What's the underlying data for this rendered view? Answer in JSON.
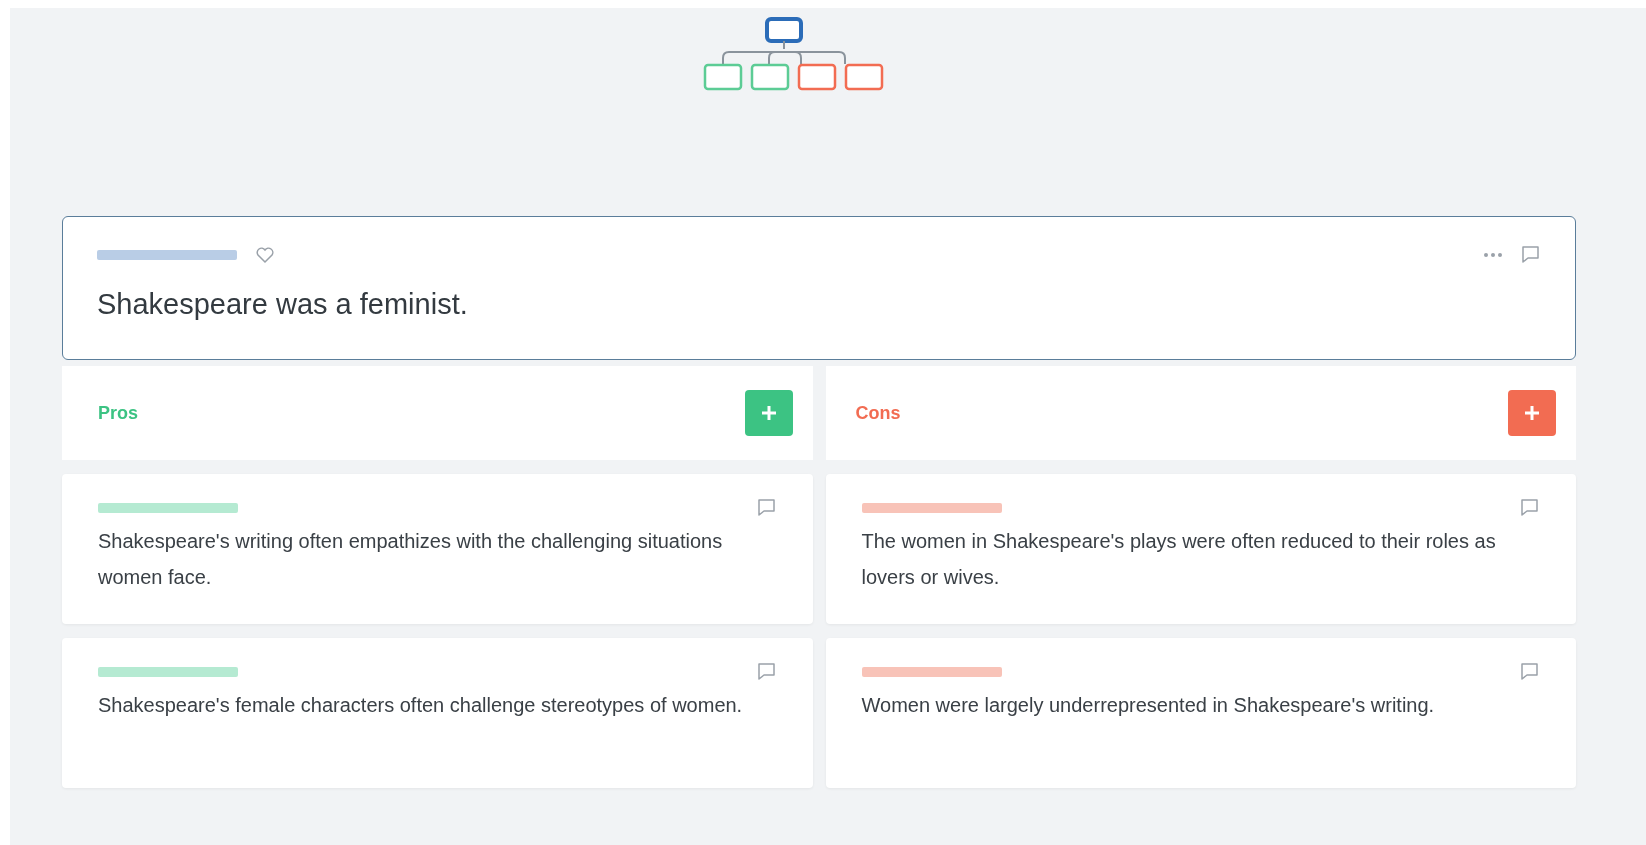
{
  "claim": {
    "text": "Shakespeare was a feminist."
  },
  "columns": [
    {
      "kind": "pro",
      "title": "Pros",
      "color": "#3cc383",
      "items": [
        {
          "text": "Shakespeare's writing often empathizes with the challenging situations women face."
        },
        {
          "text": "Shakespeare's female characters often challenge stereotypes of women."
        }
      ]
    },
    {
      "kind": "con",
      "title": "Cons",
      "color": "#f26c52",
      "items": [
        {
          "text": "The women in Shakespeare's plays were often reduced to their roles as lovers or wives."
        },
        {
          "text": "Women were largely underrepresented in Shakespeare's writing."
        }
      ]
    }
  ]
}
